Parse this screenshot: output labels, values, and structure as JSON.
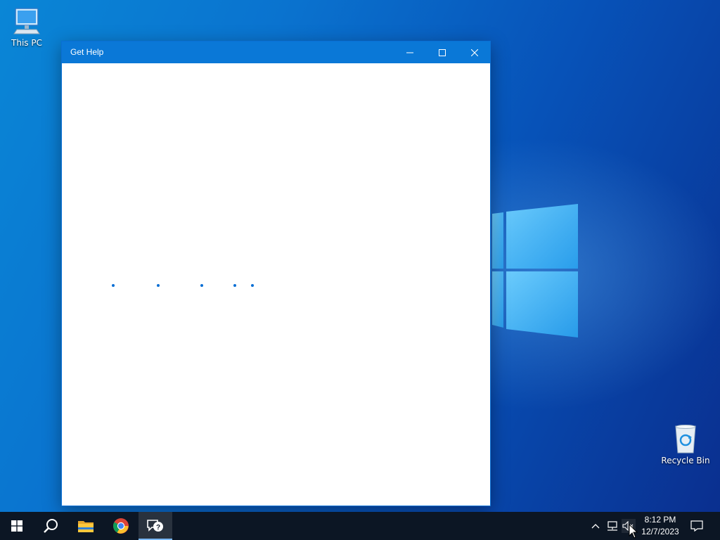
{
  "desktop": {
    "icons": [
      {
        "label": "This PC",
        "icon": "this-pc-icon"
      },
      {
        "label": "Recycle Bin",
        "icon": "recycle-bin-icon"
      }
    ]
  },
  "window": {
    "title": "Get Help",
    "state": "loading",
    "controls": [
      "minimize-icon",
      "maximize-icon",
      "close-icon"
    ]
  },
  "taskbar": {
    "items": [
      {
        "name": "start",
        "icon": "windows-logo-icon"
      },
      {
        "name": "search",
        "icon": "search-icon"
      },
      {
        "name": "file-explorer",
        "icon": "folder-icon"
      },
      {
        "name": "chrome",
        "icon": "chrome-icon"
      },
      {
        "name": "get-help",
        "icon": "get-help-icon",
        "active": true
      }
    ],
    "tray": {
      "icons": [
        "chevron-up-icon",
        "network-icon",
        "volume-muted-icon"
      ],
      "time": "8:12 PM",
      "date": "12/7/2023",
      "notification_icon": "action-center-icon"
    }
  },
  "colors": {
    "titlebar": "#0a78d7",
    "taskbar": "#0c1624",
    "accent": "#0a6fd4"
  }
}
